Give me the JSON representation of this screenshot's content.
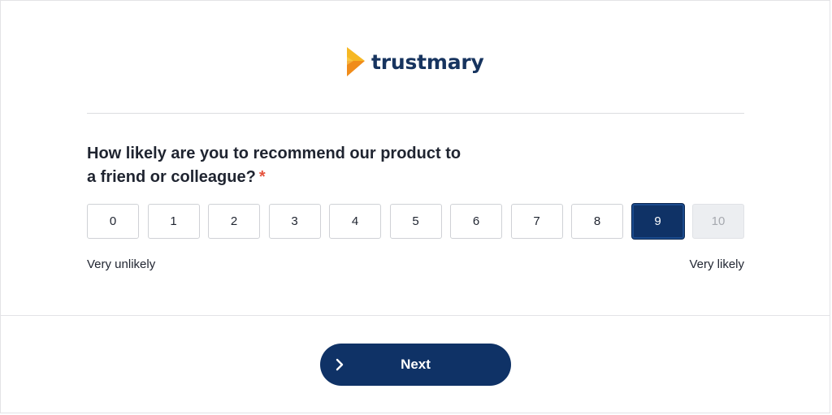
{
  "brand": {
    "name": "trustmary",
    "logo_colors": {
      "light": "#f6b824",
      "dark": "#f08c1a",
      "text": "#17345f"
    }
  },
  "question": {
    "text": "How likely are you to recommend our product to a friend or colleague?",
    "required_marker": "*"
  },
  "scale": {
    "options": [
      "0",
      "1",
      "2",
      "3",
      "4",
      "5",
      "6",
      "7",
      "8",
      "9",
      "10"
    ],
    "selected": "9",
    "disabled": "10",
    "low_label": "Very unlikely",
    "high_label": "Very likely"
  },
  "footer": {
    "next_label": "Next",
    "next_icon": "chevron-right-icon"
  },
  "colors": {
    "primary": "#0f3266",
    "required": "#e5533d",
    "disabled_bg": "#eceef1"
  }
}
